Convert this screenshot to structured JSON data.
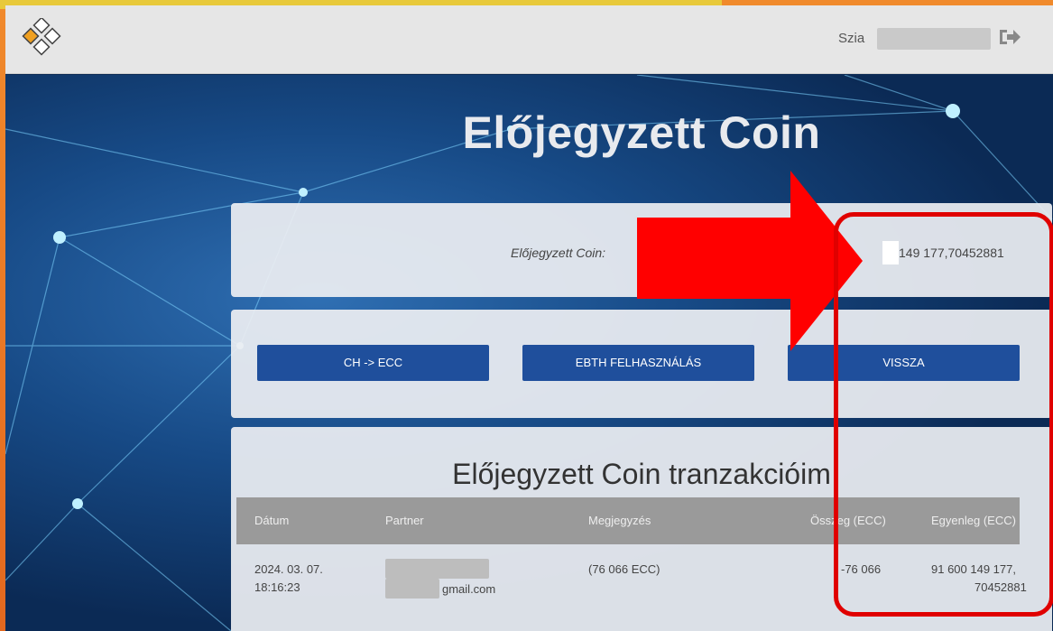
{
  "header": {
    "greeting": "Szia",
    "logout_icon": "logout-icon"
  },
  "page": {
    "title": "Előjegyzett Coin"
  },
  "balance": {
    "label": "Előjegyzett Coin:",
    "value": "149 177,70452881"
  },
  "buttons": {
    "ch_ecc": "CH -> ECC",
    "ebth": "EBTH FELHASZNÁLÁS",
    "back": "VISSZA"
  },
  "transactions": {
    "title": "Előjegyzett Coin tranzakcióim",
    "columns": [
      "Dátum",
      "Partner",
      "Megjegyzés",
      "Összeg (ECC)",
      "Egyenleg (ECC)"
    ],
    "rows": [
      {
        "date": "2024. 03. 07.",
        "time": "18:16:23",
        "partner_suffix": "gmail.com",
        "note": "(76 066 ECC)",
        "amount": "-76 066",
        "balance_line1": "91 600 149 177,",
        "balance_line2": "70452881"
      }
    ]
  },
  "colors": {
    "button": "#1f4f9c",
    "annotation": "#e00000"
  }
}
